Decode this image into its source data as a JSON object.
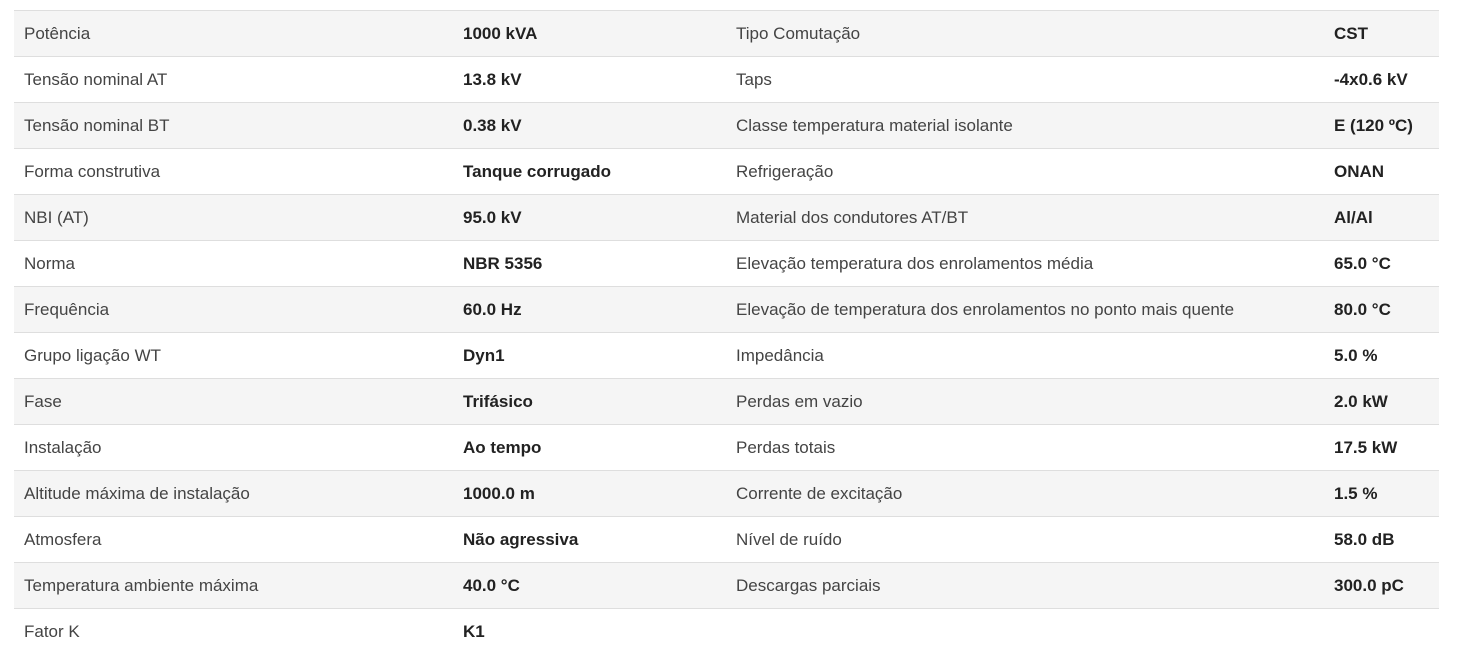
{
  "spec_table": {
    "rows": [
      {
        "label_left": "Potência",
        "value_left": "1000 kVA",
        "label_right": "Tipo Comutação",
        "value_right": "CST"
      },
      {
        "label_left": "Tensão nominal AT",
        "value_left": "13.8 kV",
        "label_right": "Taps",
        "value_right": "-4x0.6 kV"
      },
      {
        "label_left": "Tensão nominal BT",
        "value_left": "0.38 kV",
        "label_right": "Classe temperatura material isolante",
        "value_right": "E (120 ºC)"
      },
      {
        "label_left": "Forma construtiva",
        "value_left": "Tanque corrugado",
        "label_right": "Refrigeração",
        "value_right": "ONAN"
      },
      {
        "label_left": "NBI (AT)",
        "value_left": "95.0 kV",
        "label_right": "Material dos condutores AT/BT",
        "value_right": "Al/Al"
      },
      {
        "label_left": "Norma",
        "value_left": "NBR 5356",
        "label_right": "Elevação temperatura dos enrolamentos média",
        "value_right": "65.0 °C"
      },
      {
        "label_left": "Frequência",
        "value_left": "60.0 Hz",
        "label_right": "Elevação de temperatura dos enrolamentos no ponto mais quente",
        "value_right": "80.0 °C"
      },
      {
        "label_left": "Grupo ligação WT",
        "value_left": "Dyn1",
        "label_right": "Impedância",
        "value_right": "5.0 %"
      },
      {
        "label_left": "Fase",
        "value_left": "Trifásico",
        "label_right": "Perdas em vazio",
        "value_right": "2.0 kW"
      },
      {
        "label_left": "Instalação",
        "value_left": "Ao tempo",
        "label_right": "Perdas totais",
        "value_right": "17.5 kW"
      },
      {
        "label_left": "Altitude máxima de instalação",
        "value_left": "1000.0 m",
        "label_right": "Corrente de excitação",
        "value_right": "1.5 %"
      },
      {
        "label_left": "Atmosfera",
        "value_left": "Não agressiva",
        "label_right": "Nível de ruído",
        "value_right": "58.0 dB"
      },
      {
        "label_left": "Temperatura ambiente máxima",
        "value_left": "40.0 °C",
        "label_right": "Descargas parciais",
        "value_right": "300.0 pC"
      },
      {
        "label_left": "Fator K",
        "value_left": "K1",
        "label_right": "",
        "value_right": ""
      }
    ]
  }
}
